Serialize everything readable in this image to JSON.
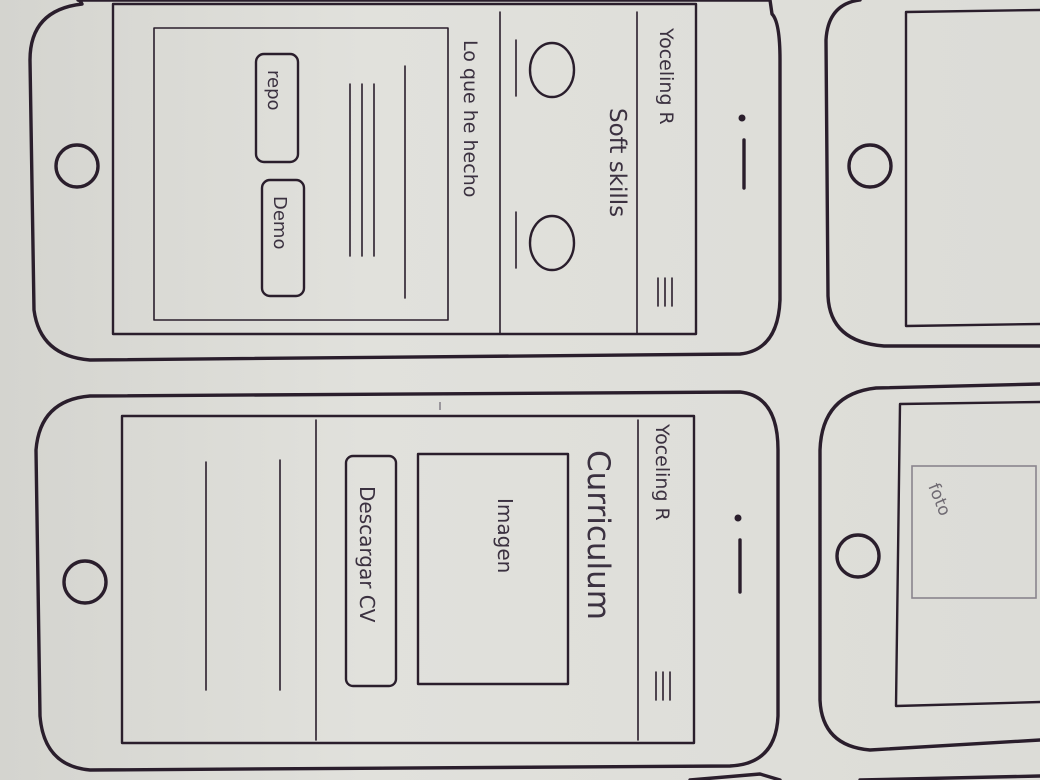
{
  "colors": {
    "paper": "#dedfda",
    "ink": "#2a1e2c",
    "pencil": "#6f6a72"
  },
  "screen1": {
    "brand": "Yoceling R",
    "section_title": "Soft skills",
    "work_title": "Lo que he hecho",
    "repo_button": "repo",
    "demo_button": "Demo",
    "menu_icon": "hamburger-icon"
  },
  "screen2": {
    "brand": "Yoceling R",
    "section_title": "Curriculum",
    "image_label": "Imagen",
    "download_button": "Descargar CV",
    "menu_icon": "hamburger-icon"
  },
  "screen4": {
    "photo_label": "foto"
  }
}
